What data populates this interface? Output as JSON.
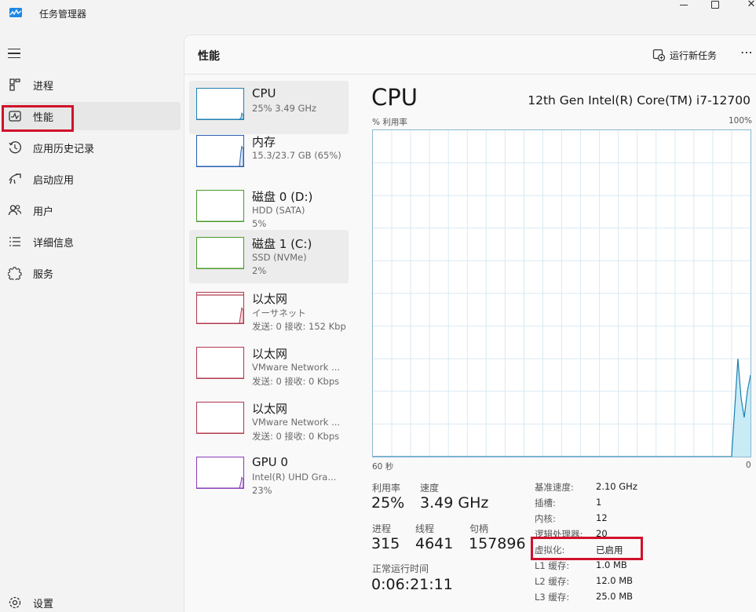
{
  "app": {
    "title": "任务管理器"
  },
  "sidebar": {
    "items": [
      {
        "label": "进程",
        "icon": "processes-icon"
      },
      {
        "label": "性能",
        "icon": "performance-icon",
        "active": true
      },
      {
        "label": "应用历史记录",
        "icon": "app-history-icon"
      },
      {
        "label": "启动应用",
        "icon": "startup-apps-icon"
      },
      {
        "label": "用户",
        "icon": "users-icon"
      },
      {
        "label": "详细信息",
        "icon": "details-icon"
      },
      {
        "label": "服务",
        "icon": "services-icon"
      }
    ],
    "settings_label": "设置"
  },
  "main": {
    "title": "性能",
    "run_task_label": "运行新任务",
    "more_label": "⋯"
  },
  "devices": [
    {
      "name": "CPU",
      "sub1": "25%  3.49 GHz",
      "sub2": "",
      "selected": true,
      "color": "#1d7fb2",
      "fill": "#c9e8f5",
      "level": 0.2
    },
    {
      "name": "内存",
      "sub1": "15.3/23.7 GB (65%)",
      "sub2": "",
      "color": "#2a5db0",
      "fill": "#dfe8f7",
      "level": 0.65
    },
    {
      "name": "磁盘 0 (D:)",
      "sub1": "HDD (SATA)",
      "sub2": "5%",
      "color": "#4a9a2c",
      "fill": "#e2f1da",
      "level": 0.0
    },
    {
      "name": "磁盘 1 (C:)",
      "sub1": "SSD (NVMe)",
      "sub2": "2%",
      "selected": true,
      "color": "#4a9a2c",
      "fill": "#e2f1da",
      "level": 0.0
    },
    {
      "name": "以太网",
      "sub1": "イーサネット",
      "sub2": "发送: 0 接收: 152 Kbp",
      "color": "#b2384e",
      "fill": "#f6dde2",
      "level": 0.5
    },
    {
      "name": "以太网",
      "sub1": "VMware Network ...",
      "sub2": "发送: 0 接收: 0 Kbps",
      "color": "#b2384e",
      "fill": "#f6dde2",
      "level": 0.0
    },
    {
      "name": "以太网",
      "sub1": "VMware Network ...",
      "sub2": "发送: 0 接收: 0 Kbps",
      "color": "#b2384e",
      "fill": "#f6dde2",
      "level": 0.0
    },
    {
      "name": "GPU 0",
      "sub1": "Intel(R) UHD Gra...",
      "sub2": "23%",
      "color": "#8a3bb8",
      "fill": "#eadcf5",
      "level": 0.35
    }
  ],
  "cpu": {
    "heading": "CPU",
    "model": "12th Gen Intel(R) Core(TM) i7-12700",
    "y_label": "% 利用率",
    "y_max_label": "100%",
    "x_left_label": "60 秒",
    "x_right_label": "0",
    "chart_color": "#1d7fb2",
    "chart_fill": "#c9ebf6",
    "stats": {
      "util_label": "利用率",
      "util_value": "25%",
      "speed_label": "速度",
      "speed_value": "3.49 GHz",
      "proc_label": "进程",
      "proc_value": "315",
      "thread_label": "线程",
      "thread_value": "4641",
      "handle_label": "句柄",
      "handle_value": "157896",
      "uptime_label": "正常运行时间",
      "uptime_value": "0:06:21:11"
    },
    "details": [
      {
        "k": "基准速度:",
        "v": "2.10 GHz"
      },
      {
        "k": "插槽:",
        "v": "1"
      },
      {
        "k": "内核:",
        "v": "12"
      },
      {
        "k": "逻辑处理器:",
        "v": "20"
      },
      {
        "k": "虚拟化:",
        "v": "已启用"
      },
      {
        "k": "L1 缓存:",
        "v": "1.0 MB"
      },
      {
        "k": "L2 缓存:",
        "v": "12.0 MB"
      },
      {
        "k": "L3 缓存:",
        "v": "25.0 MB"
      }
    ]
  },
  "chart_data": {
    "type": "area",
    "xlabel": "",
    "ylabel": "% 利用率",
    "x": [
      60,
      3,
      2,
      1.5,
      1,
      0.5,
      0
    ],
    "values": [
      0,
      0,
      30,
      18,
      12,
      20,
      25
    ],
    "ylim": [
      0,
      100
    ],
    "xlim": [
      60,
      0
    ],
    "grid": true
  }
}
